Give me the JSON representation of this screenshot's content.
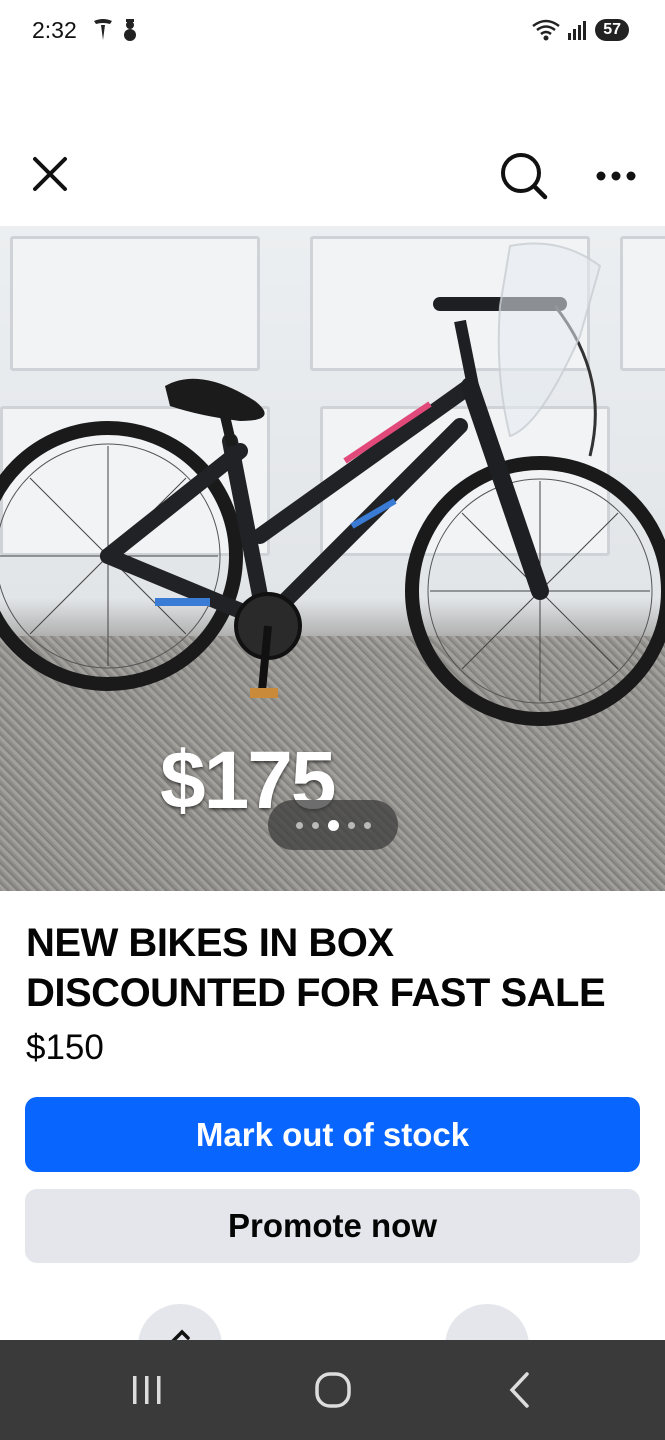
{
  "status_bar": {
    "time": "2:32",
    "battery": "57",
    "icons": [
      "tesla-icon",
      "snowman-icon",
      "wifi-icon",
      "signal-icon",
      "battery-icon"
    ]
  },
  "top_bar": {
    "icons": [
      "close-icon",
      "search-icon",
      "more-icon"
    ]
  },
  "photo": {
    "price_overlay": "$175",
    "pager": {
      "count": 5,
      "active_index": 2
    }
  },
  "listing": {
    "title": "NEW BIKES IN BOX DISCOUNTED FOR FAST SALE",
    "price": "$150"
  },
  "actions": {
    "primary_label": "Mark out of stock",
    "secondary_label": "Promote now",
    "primary_color": "#0866ff",
    "secondary_color": "#e4e6eb"
  },
  "nav_bar": {
    "icons": [
      "recent-apps-icon",
      "home-icon",
      "back-icon"
    ]
  }
}
